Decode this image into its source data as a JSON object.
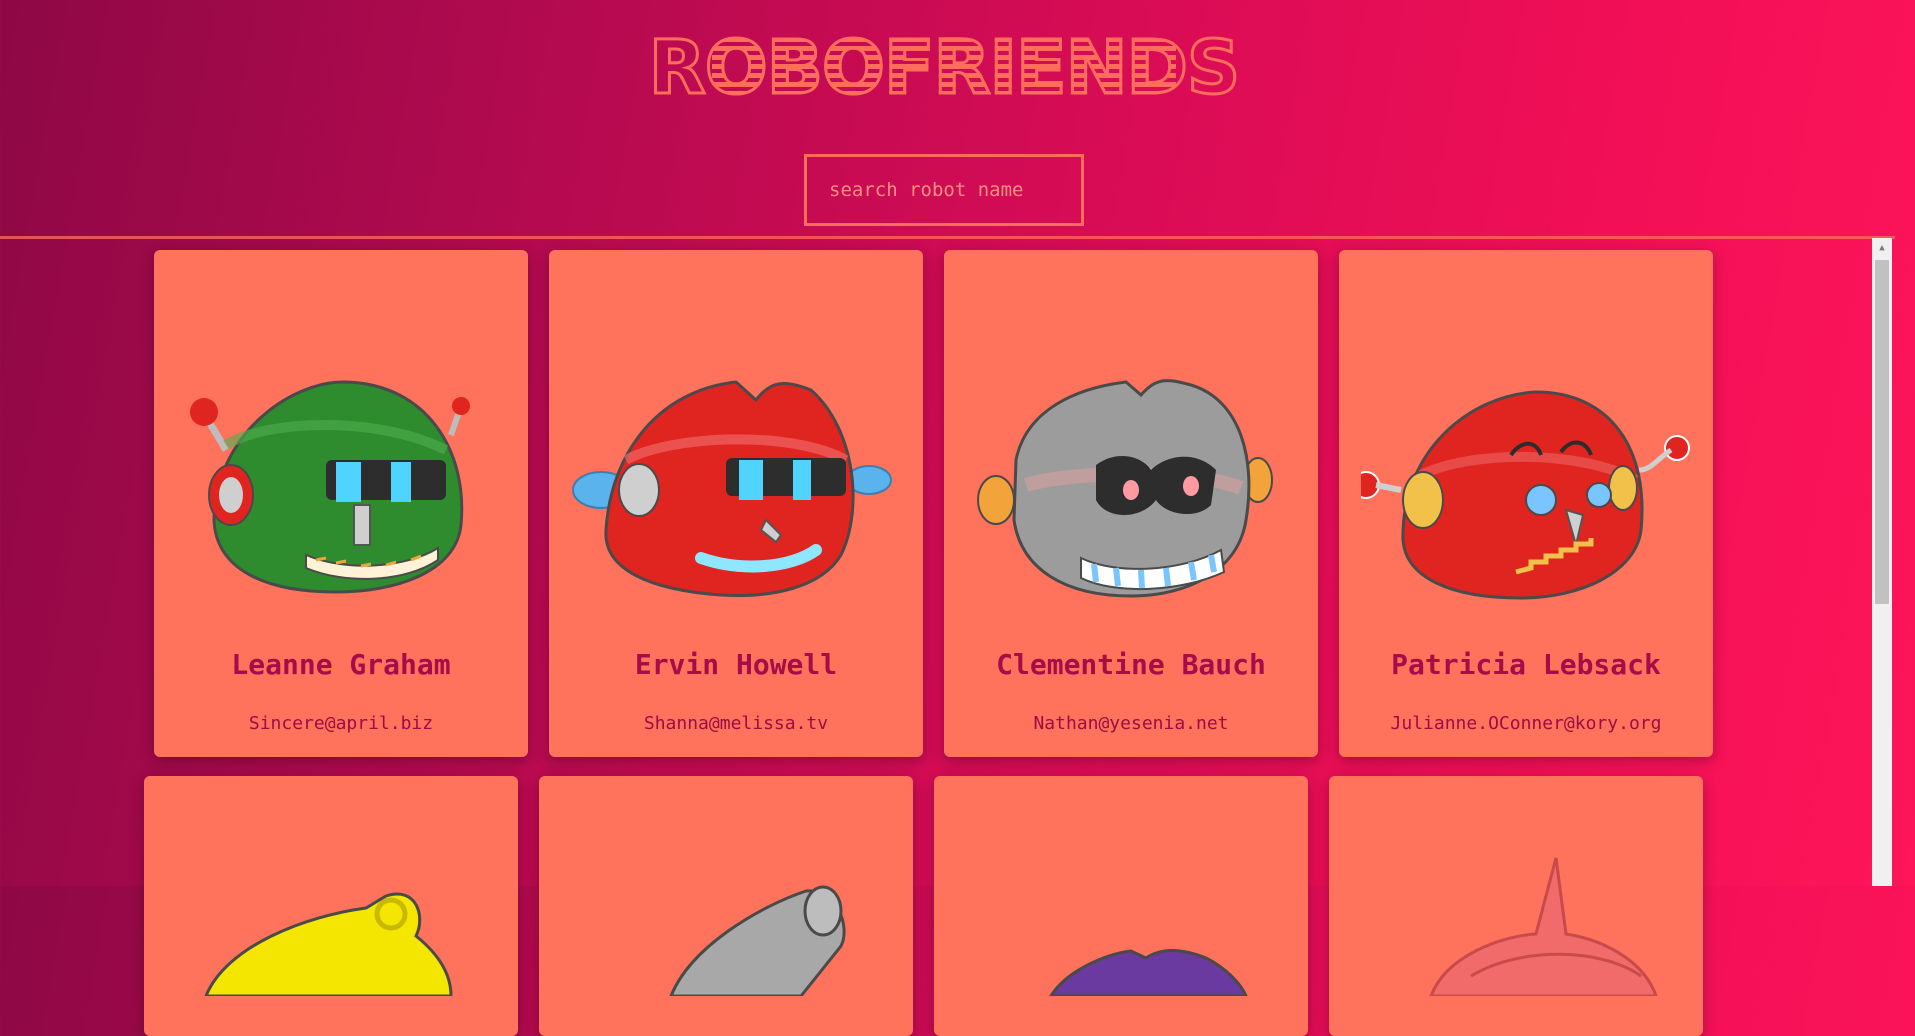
{
  "header": {
    "title": "ROBOFRIENDS"
  },
  "search": {
    "placeholder": "search robot name",
    "value": ""
  },
  "robots": [
    {
      "name": "Leanne Graham",
      "email": "Sincere@april.biz",
      "color": "#2e8b2e"
    },
    {
      "name": "Ervin Howell",
      "email": "Shanna@melissa.tv",
      "color": "#e0241f"
    },
    {
      "name": "Clementine Bauch",
      "email": "Nathan@yesenia.net",
      "color": "#9c9c9c"
    },
    {
      "name": "Patricia Lebsack",
      "email": "Julianne.OConner@kory.org",
      "color": "#e0241f"
    }
  ],
  "robots_partial": [
    {
      "color": "#f5e600"
    },
    {
      "color": "#a8a8a8"
    },
    {
      "color": "#6b3aa0"
    },
    {
      "color": "#f26b6b"
    }
  ],
  "colors": {
    "accent": "#ff725b",
    "text": "#a60d48",
    "background_start": "#8e0845",
    "background_end": "#ff1558"
  }
}
